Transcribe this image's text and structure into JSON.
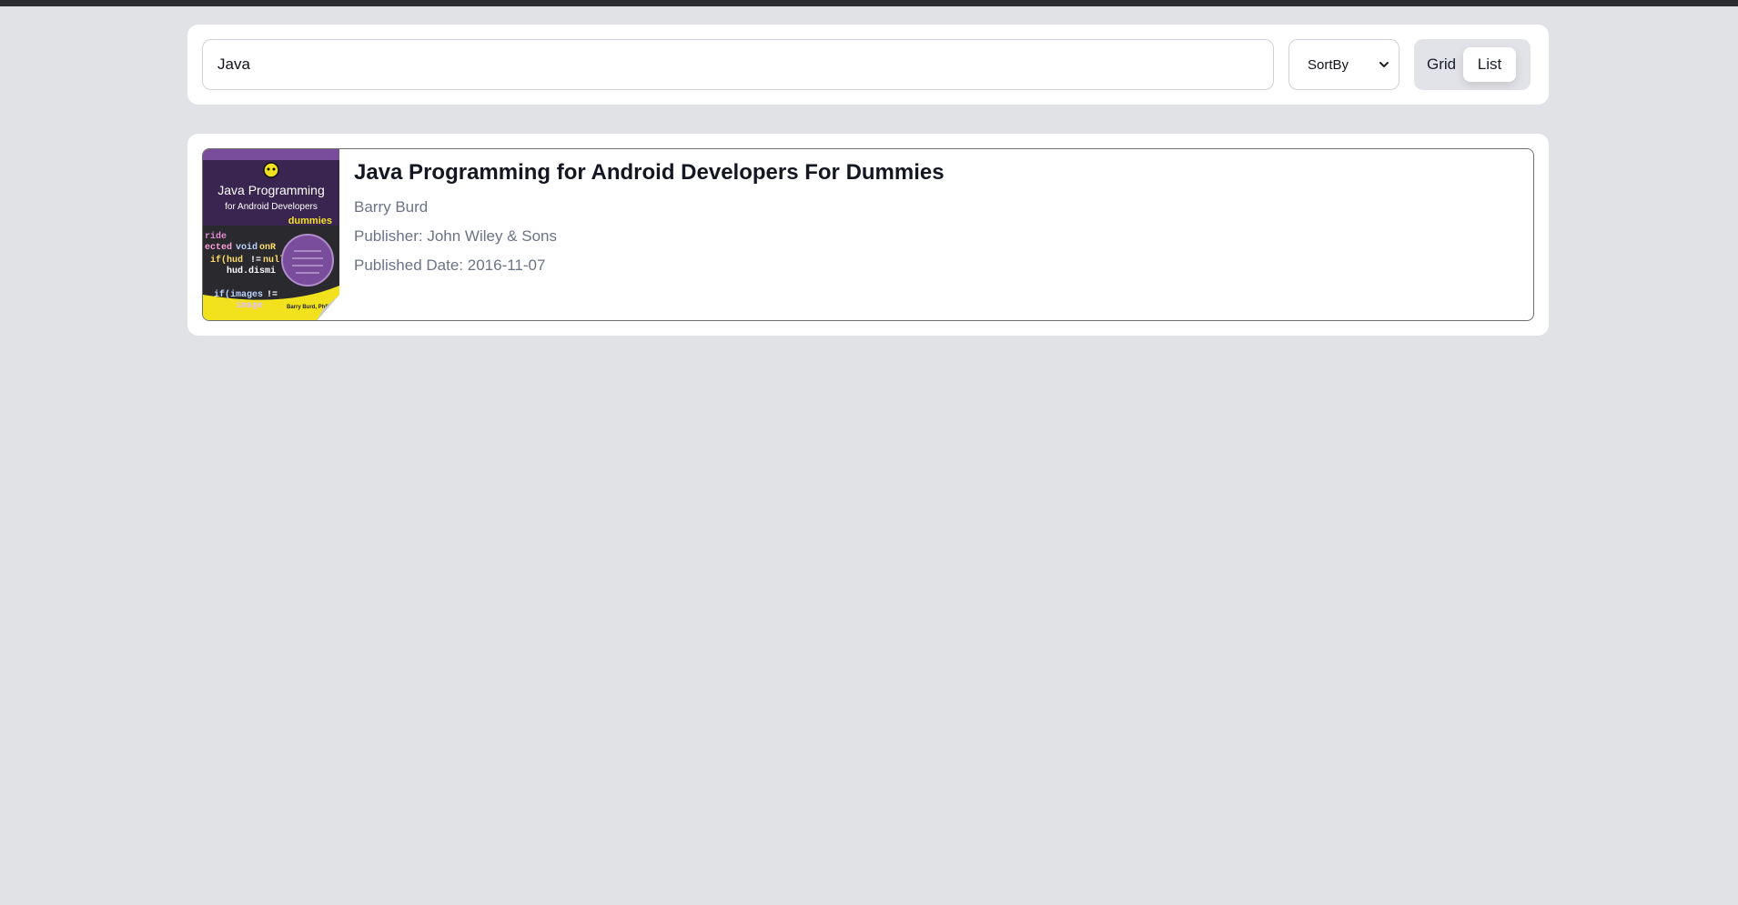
{
  "search": {
    "value": "Java",
    "placeholder": ""
  },
  "sort": {
    "selected": "SortBy"
  },
  "view_toggle": {
    "grid_label": "Grid",
    "list_label": "List",
    "active": "List"
  },
  "results": [
    {
      "title": "Java Programming for Android Developers For Dummies",
      "author": "Barry Burd",
      "publisher": "Publisher: John Wiley & Sons",
      "published_date": "Published Date: 2016-11-07",
      "cover": {
        "title_line1": "Java Programming",
        "title_line2": "for Android Developers",
        "brand": "dummies",
        "author": "Barry Burd, PhD"
      }
    }
  ],
  "colors": {
    "background": "#e1e2e6",
    "panel": "#ffffff",
    "cover_purple": "#7a4d9c",
    "cover_yellow": "#f2e21d"
  }
}
